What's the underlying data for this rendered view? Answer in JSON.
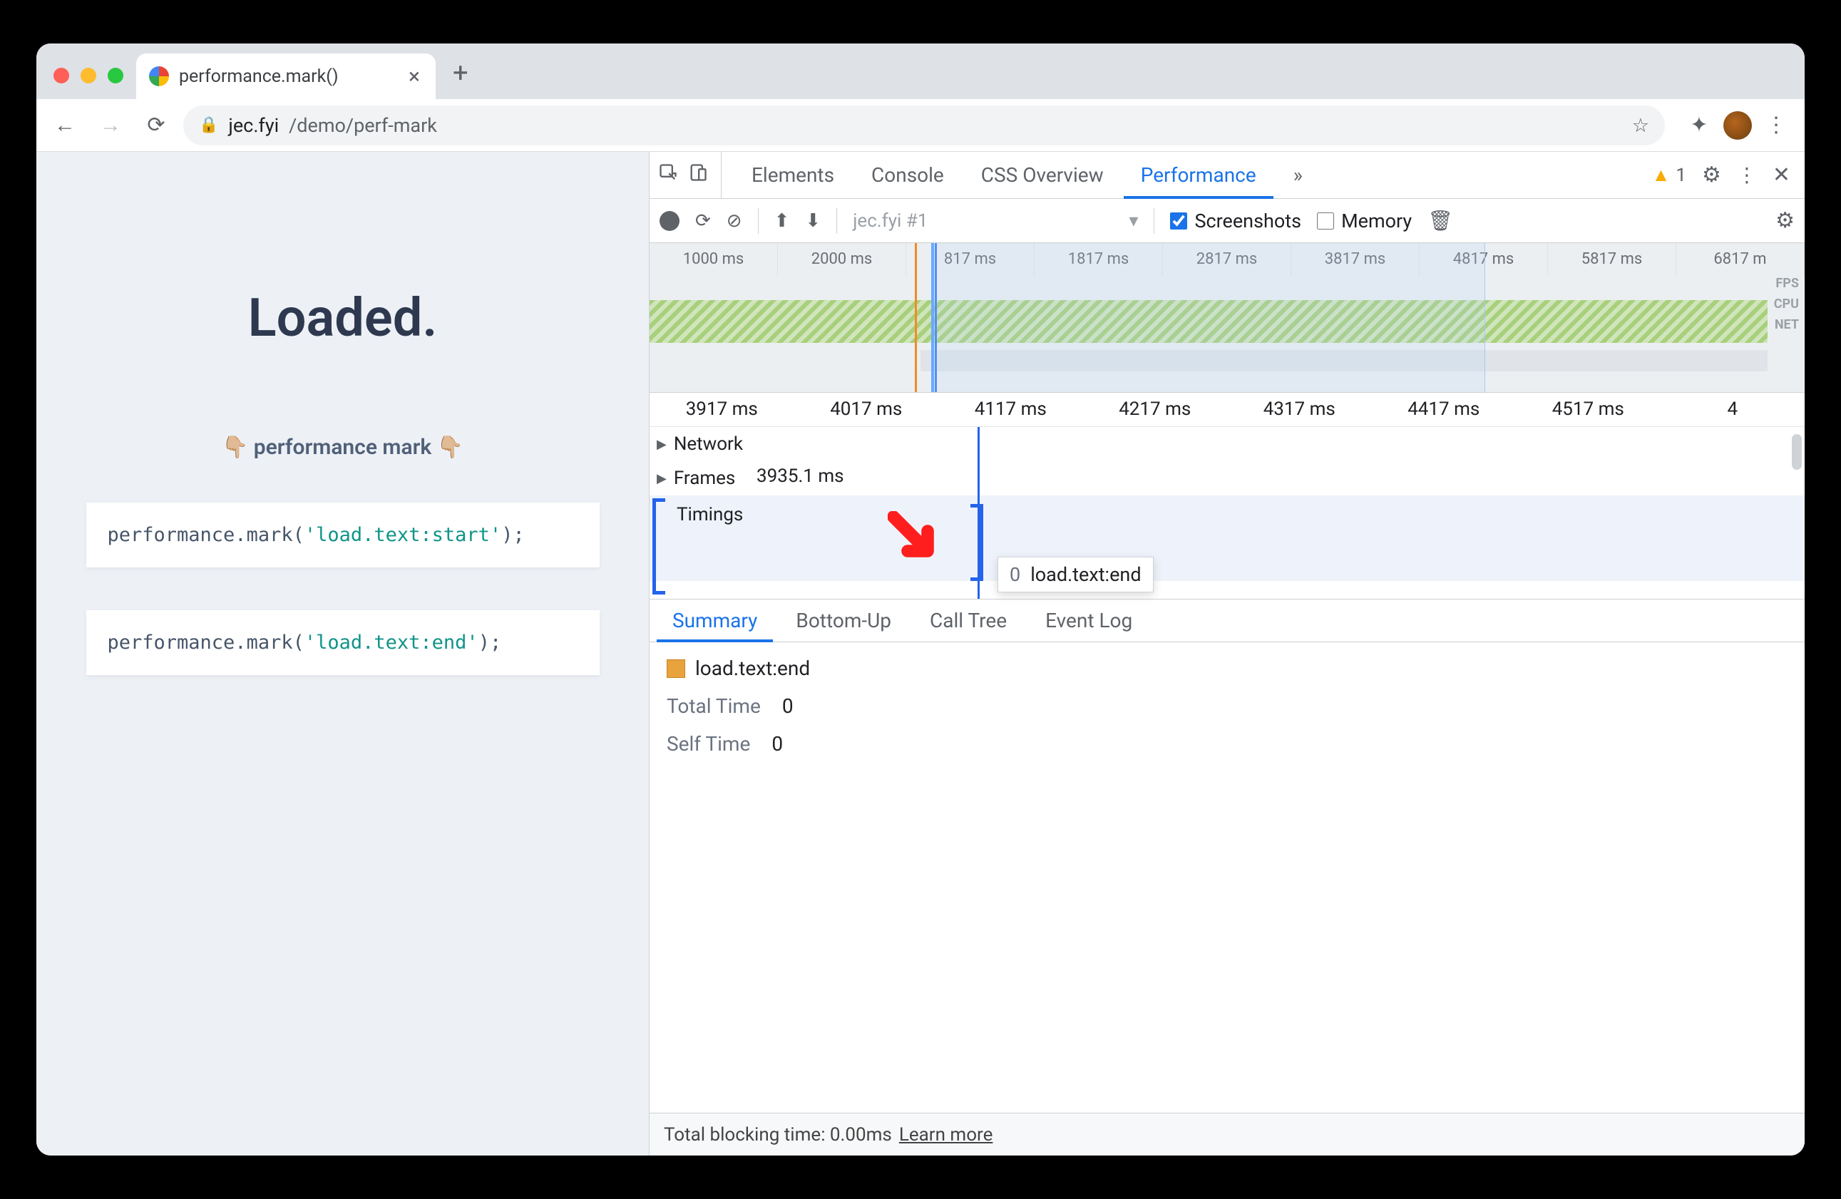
{
  "browser": {
    "tab_title": "performance.mark()",
    "url_host": "jec.fyi",
    "url_path": "/demo/perf-mark"
  },
  "page": {
    "heading": "Loaded.",
    "subtitle": "👇🏼 performance mark 👇🏼",
    "code1_pre": "performance.mark(",
    "code1_str": "'load.text:start'",
    "code1_post": ");",
    "code2_pre": "performance.mark(",
    "code2_str": "'load.text:end'",
    "code2_post": ");"
  },
  "devtools": {
    "tabs": {
      "elements": "Elements",
      "console": "Console",
      "css_overview": "CSS Overview",
      "performance": "Performance",
      "more": "»"
    },
    "warnings_count": "1",
    "toolbar": {
      "recording_label": "jec.fyi #1",
      "screenshots": "Screenshots",
      "memory": "Memory"
    },
    "overview": {
      "ticks": [
        "1000 ms",
        "2000 ms",
        "817 ms",
        "1817 ms",
        "2817 ms",
        "3817 ms",
        "4817 ms",
        "5817 ms",
        "6817 m"
      ],
      "labels": {
        "fps": "FPS",
        "cpu": "CPU",
        "net": "NET"
      }
    },
    "detail_ruler": [
      "3917 ms",
      "4017 ms",
      "4117 ms",
      "4217 ms",
      "4317 ms",
      "4417 ms",
      "4517 ms",
      "4"
    ],
    "tracks": {
      "network": "Network",
      "frames": "Frames",
      "frames_value": "3935.1 ms",
      "timings": "Timings"
    },
    "tooltip": {
      "value": "0",
      "label": "load.text:end"
    },
    "subtabs": {
      "summary": "Summary",
      "bottom_up": "Bottom-Up",
      "call_tree": "Call Tree",
      "event_log": "Event Log"
    },
    "summary": {
      "title": "load.text:end",
      "total_label": "Total Time",
      "total_value": "0",
      "self_label": "Self Time",
      "self_value": "0"
    },
    "footer": {
      "text": "Total blocking time: 0.00ms",
      "link": "Learn more"
    }
  }
}
